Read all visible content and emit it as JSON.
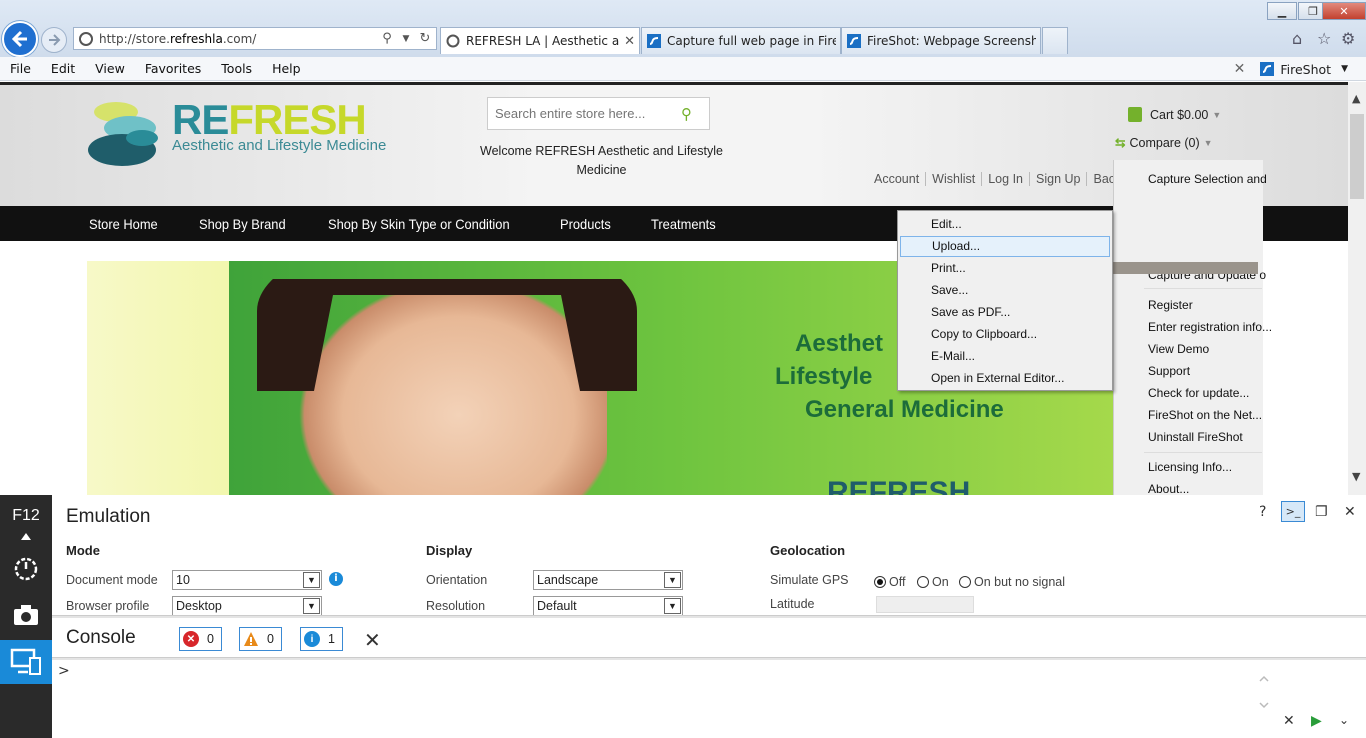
{
  "browser": {
    "address": {
      "prefix": "http://store.",
      "domain": "refreshla",
      "suffix": ".com/"
    },
    "tabs": [
      {
        "label": "REFRESH LA | Aesthetic and...",
        "active": true
      },
      {
        "label": "Capture full web page in Firef...",
        "active": false
      },
      {
        "label": "FireShot: Webpage Screenshot...",
        "active": false
      }
    ],
    "menubar": [
      "File",
      "Edit",
      "View",
      "Favorites",
      "Tools",
      "Help"
    ],
    "fireshot_toolbar": "FireShot"
  },
  "site": {
    "logo": {
      "part1": "RE",
      "part2": "FRESH",
      "tagline": "Aesthetic and Lifestyle Medicine"
    },
    "search_placeholder": "Search entire store here...",
    "welcome": "Welcome REFRESH Aesthetic and Lifestyle Medicine",
    "cart": "Cart $0.00",
    "compare": "Compare (0)",
    "account_links": [
      "Account",
      "Wishlist",
      "Log In",
      "Sign Up",
      "Back"
    ],
    "nav": [
      "Store Home",
      "Shop By Brand",
      "Shop By Skin Type or Condition",
      "Products",
      "Treatments"
    ],
    "banner": {
      "line1": "Aesthet",
      "line2": "Lifestyle",
      "line3": "General Medicine",
      "bottom": "REFRESH"
    }
  },
  "context_menu": {
    "items": [
      "Edit...",
      "Upload...",
      "Print...",
      "Save...",
      "Save as PDF...",
      "Copy to Clipboard...",
      "E-Mail...",
      "Open in External Editor..."
    ],
    "highlighted": "Upload..."
  },
  "fireshot_menu": {
    "items": [
      "Capture Selection and",
      "Capture and Update o",
      "Register",
      "Enter registration info...",
      "View Demo",
      "Support",
      "Check for update...",
      "FireShot on the Net...",
      "Uninstall FireShot",
      "Licensing Info...",
      "About..."
    ]
  },
  "devtools": {
    "label": "F12",
    "panel_title": "Emulation",
    "mode": {
      "heading": "Mode",
      "document_mode_label": "Document mode",
      "document_mode_value": "10",
      "browser_profile_label": "Browser profile",
      "browser_profile_value": "Desktop"
    },
    "display": {
      "heading": "Display",
      "orientation_label": "Orientation",
      "orientation_value": "Landscape",
      "resolution_label": "Resolution",
      "resolution_value": "Default"
    },
    "geolocation": {
      "heading": "Geolocation",
      "simulate_label": "Simulate GPS",
      "options": [
        "Off",
        "On",
        "On but no signal"
      ],
      "selected": "Off",
      "latitude_label": "Latitude"
    },
    "console": {
      "title": "Console",
      "errors": "0",
      "warnings": "0",
      "info": "1",
      "prompt": ">"
    },
    "help": "?"
  },
  "colors": {
    "accent_blue": "#1a8ad8",
    "brand_teal": "#2a8c98",
    "brand_lime": "#c6d82a",
    "nav_bg": "#111111"
  }
}
